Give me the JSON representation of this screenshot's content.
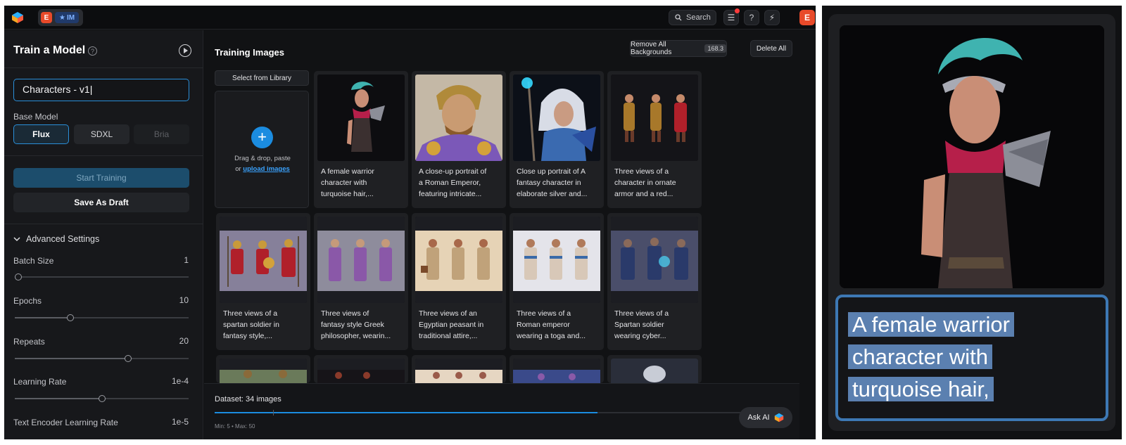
{
  "topbar": {
    "workspace_initial": "E",
    "workspace_badge": "IM",
    "search_label": "Search",
    "avatar_initial": "E"
  },
  "sidebar": {
    "title": "Train a Model",
    "model_name_value": "Characters - v1",
    "base_model_label": "Base Model",
    "base_models": [
      "Flux",
      "SDXL",
      "Bria"
    ],
    "selected_model": "Flux",
    "start_training_label": "Start Training",
    "save_draft_label": "Save As Draft",
    "advanced_label": "Advanced Settings",
    "settings": [
      {
        "label": "Batch Size",
        "value": "1",
        "slider_fraction": 0.02
      },
      {
        "label": "Epochs",
        "value": "10",
        "slider_fraction": 0.32
      },
      {
        "label": "Repeats",
        "value": "20",
        "slider_fraction": 0.65
      },
      {
        "label": "Learning Rate",
        "value": "1e-4",
        "slider_fraction": 0.5
      },
      {
        "label": "Text Encoder Learning Rate",
        "value": "1e-5"
      }
    ]
  },
  "main": {
    "title": "Training Images",
    "remove_bg_label": "Remove All Backgrounds",
    "remove_bg_credits": "168.3",
    "delete_all_label": "Delete All",
    "select_library_label": "Select from Library",
    "upload_text_1": "Drag & drop, paste",
    "upload_text_2": "or",
    "upload_link": "upload images",
    "cards": [
      {
        "caption_1": "A female warrior",
        "caption_2": "character with",
        "caption_3": "turquoise hair,..."
      },
      {
        "caption_1": "A close-up portrait of",
        "caption_2": "a Roman Emperor,",
        "caption_3": "featuring intricate..."
      },
      {
        "caption_1": "Close up portrait of A",
        "caption_2": "fantasy character in",
        "caption_3": "elaborate silver and..."
      },
      {
        "caption_1": "Three views of a",
        "caption_2": "character in ornate",
        "caption_3": "armor and a red..."
      },
      {
        "caption_1": "Three views of a",
        "caption_2": "spartan soldier in",
        "caption_3": "fantasy style,..."
      },
      {
        "caption_1": "Three views of",
        "caption_2": "fantasy style Greek",
        "caption_3": "philosopher, wearin..."
      },
      {
        "caption_1": "Three views of an",
        "caption_2": "Egyptian peasant in",
        "caption_3": "traditional attire,..."
      },
      {
        "caption_1": "Three views of a",
        "caption_2": "Roman emperor",
        "caption_3": "wearing a toga and..."
      },
      {
        "caption_1": "Three views of a",
        "caption_2": "Spartan soldier",
        "caption_3": "wearing cyber..."
      }
    ],
    "dataset_label": "Dataset: 34 images",
    "dataset_fraction": 0.68,
    "min_max": "Min: 5  •  Max: 50",
    "ask_ai_label": "Ask AI"
  },
  "zoom": {
    "caption_1": "A female  warrior",
    "caption_2": "character with",
    "caption_3": "turquoise hair,"
  },
  "colors": {
    "accent": "#2a8fd9",
    "brand_orange": "#e84a2a",
    "highlight": "#5b80b0"
  }
}
